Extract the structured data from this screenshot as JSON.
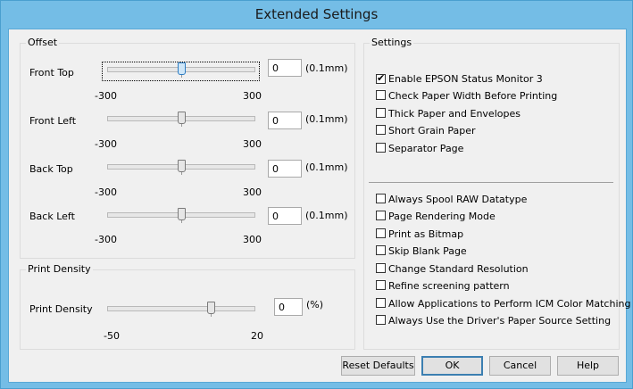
{
  "window": {
    "title": "Extended Settings"
  },
  "offset": {
    "label": "Offset",
    "unit": "(0.1mm)",
    "rows": [
      {
        "label": "Front Top",
        "min": "-300",
        "max": "300",
        "value": "0",
        "level": 0
      },
      {
        "label": "Front Left",
        "min": "-300",
        "max": "300",
        "value": "0",
        "level": 0
      },
      {
        "label": "Back Top",
        "min": "-300",
        "max": "300",
        "value": "0",
        "level": 0
      },
      {
        "label": "Back Left",
        "min": "-300",
        "max": "300",
        "value": "0",
        "level": 0
      }
    ]
  },
  "density": {
    "label": "Print Density",
    "row": {
      "label": "Print Density",
      "min": "-50",
      "max": "20",
      "value": "0",
      "unit": "(%)"
    }
  },
  "settings": {
    "label": "Settings",
    "group1": [
      {
        "label": "Enable EPSON Status Monitor 3",
        "checked": true
      },
      {
        "label": "Check Paper Width Before Printing",
        "checked": false
      },
      {
        "label": "Thick Paper and Envelopes",
        "checked": false
      },
      {
        "label": "Short Grain Paper",
        "checked": false
      },
      {
        "label": "Separator Page",
        "checked": false
      }
    ],
    "group2": [
      {
        "label": "Always Spool RAW Datatype",
        "checked": false
      },
      {
        "label": "Page Rendering Mode",
        "checked": false
      },
      {
        "label": "Print as Bitmap",
        "checked": false
      },
      {
        "label": "Skip Blank Page",
        "checked": false
      },
      {
        "label": "Change Standard Resolution",
        "checked": false
      },
      {
        "label": "Refine screening pattern",
        "checked": false
      },
      {
        "label": "Allow Applications to Perform ICM Color Matching",
        "checked": false
      },
      {
        "label": "Always Use the Driver's Paper Source Setting",
        "checked": false
      }
    ]
  },
  "buttons": {
    "reset": "Reset Defaults",
    "ok": "OK",
    "cancel": "Cancel",
    "help": "Help"
  }
}
